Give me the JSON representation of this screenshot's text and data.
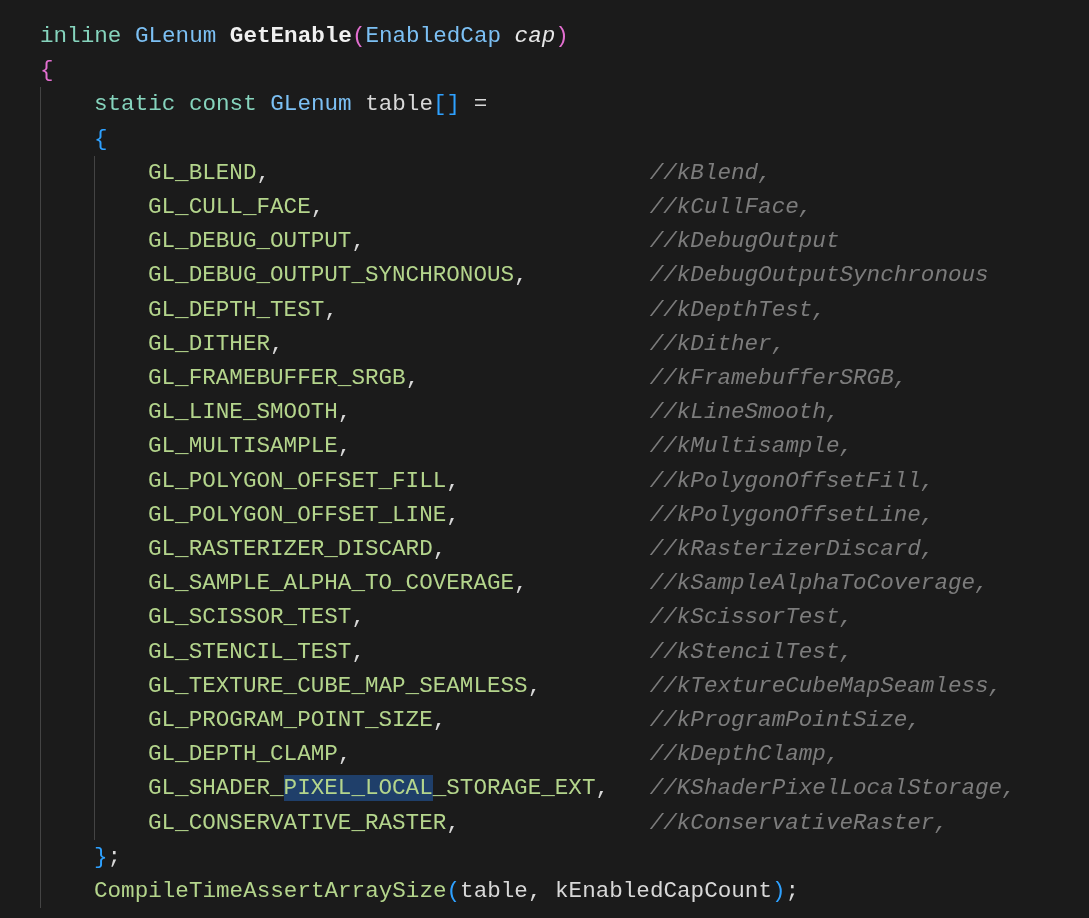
{
  "code": {
    "signature": [
      {
        "text": "inline",
        "kind": "keyword",
        "space_before": false
      },
      {
        "text": "GLenum",
        "kind": "type",
        "space_before": true
      },
      {
        "text": "GetEnable",
        "kind": "function",
        "space_before": true
      },
      {
        "text": "(",
        "kind": "bracket1",
        "space_before": false
      },
      {
        "text": "EnabledCap",
        "kind": "type",
        "space_before": false
      },
      {
        "text": "cap",
        "kind": "param",
        "space_before": true
      },
      {
        "text": ")",
        "kind": "bracket1",
        "space_before": false
      }
    ],
    "open_brace": "{",
    "declaration": {
      "tokens": [
        {
          "text": "static",
          "kind": "keyword",
          "space_before": false
        },
        {
          "text": "const",
          "kind": "keyword",
          "space_before": true
        },
        {
          "text": "GLenum",
          "kind": "type",
          "space_before": true
        },
        {
          "text": "table",
          "kind": "plain",
          "space_before": true
        },
        {
          "text": "[]",
          "kind": "bracket2",
          "space_before": false
        },
        {
          "text": "=",
          "kind": "plain",
          "space_before": true
        }
      ],
      "open_brace": "{",
      "entries": [
        {
          "parts": [
            {
              "text": "GL_BLEND",
              "selected": false
            }
          ],
          "punct": ",",
          "comment": "//kBlend,"
        },
        {
          "parts": [
            {
              "text": "GL_CULL_FACE",
              "selected": false
            }
          ],
          "punct": ",",
          "comment": "//kCullFace,"
        },
        {
          "parts": [
            {
              "text": "GL_DEBUG_OUTPUT",
              "selected": false
            }
          ],
          "punct": ",",
          "comment": "//kDebugOutput"
        },
        {
          "parts": [
            {
              "text": "GL_DEBUG_OUTPUT_SYNCHRONOUS",
              "selected": false
            }
          ],
          "punct": ",",
          "comment": "//kDebugOutputSynchronous"
        },
        {
          "parts": [
            {
              "text": "GL_DEPTH_TEST",
              "selected": false
            }
          ],
          "punct": ",",
          "comment": "//kDepthTest,"
        },
        {
          "parts": [
            {
              "text": "GL_DITHER",
              "selected": false
            }
          ],
          "punct": ",",
          "comment": "//kDither,"
        },
        {
          "parts": [
            {
              "text": "GL_FRAMEBUFFER_SRGB",
              "selected": false
            }
          ],
          "punct": ",",
          "comment": "//kFramebufferSRGB,"
        },
        {
          "parts": [
            {
              "text": "GL_LINE_SMOOTH",
              "selected": false
            }
          ],
          "punct": ",",
          "comment": "//kLineSmooth,"
        },
        {
          "parts": [
            {
              "text": "GL_MULTISAMPLE",
              "selected": false
            }
          ],
          "punct": ",",
          "comment": "//kMultisample,"
        },
        {
          "parts": [
            {
              "text": "GL_POLYGON_OFFSET_FILL",
              "selected": false
            }
          ],
          "punct": ",",
          "comment": "//kPolygonOffsetFill,"
        },
        {
          "parts": [
            {
              "text": "GL_POLYGON_OFFSET_LINE",
              "selected": false
            }
          ],
          "punct": ",",
          "comment": "//kPolygonOffsetLine,"
        },
        {
          "parts": [
            {
              "text": "GL_RASTERIZER_DISCARD",
              "selected": false
            }
          ],
          "punct": ",",
          "comment": "//kRasterizerDiscard,"
        },
        {
          "parts": [
            {
              "text": "GL_SAMPLE_ALPHA_TO_COVERAGE",
              "selected": false
            }
          ],
          "punct": ",",
          "comment": "//kSampleAlphaToCoverage,"
        },
        {
          "parts": [
            {
              "text": "GL_SCISSOR_TEST",
              "selected": false
            }
          ],
          "punct": ",",
          "comment": "//kScissorTest,"
        },
        {
          "parts": [
            {
              "text": "GL_STENCIL_TEST",
              "selected": false
            }
          ],
          "punct": ",",
          "comment": "//kStencilTest,"
        },
        {
          "parts": [
            {
              "text": "GL_TEXTURE_CUBE_MAP_SEAMLESS",
              "selected": false
            }
          ],
          "punct": ",",
          "comment": "//kTextureCubeMapSeamless,"
        },
        {
          "parts": [
            {
              "text": "GL_PROGRAM_POINT_SIZE",
              "selected": false
            }
          ],
          "punct": ",",
          "comment": "//kProgramPointSize,"
        },
        {
          "parts": [
            {
              "text": "GL_DEPTH_CLAMP",
              "selected": false
            }
          ],
          "punct": ",",
          "comment": "//kDepthClamp,"
        },
        {
          "parts": [
            {
              "text": "GL_SHADER_",
              "selected": false
            },
            {
              "text": "PIXEL_LOCAL",
              "selected": true
            },
            {
              "text": "_STORAGE_EXT",
              "selected": false
            }
          ],
          "punct": ",",
          "comment": "//KShaderPixelLocalStorage,"
        },
        {
          "parts": [
            {
              "text": "GL_CONSERVATIVE_RASTER",
              "selected": false
            }
          ],
          "punct": ",",
          "comment": "//kConservativeRaster,"
        }
      ],
      "close": [
        {
          "text": "}",
          "kind": "bracket2",
          "space_before": false
        },
        {
          "text": ";",
          "kind": "plain",
          "space_before": false
        }
      ]
    },
    "call": [
      {
        "text": "CompileTimeAssertArraySize",
        "kind": "call",
        "space_before": false
      },
      {
        "text": "(",
        "kind": "bracket2",
        "space_before": false
      },
      {
        "text": "table,",
        "kind": "plain",
        "space_before": false
      },
      {
        "text": "kEnabledCapCount",
        "kind": "plain",
        "space_before": true
      },
      {
        "text": ")",
        "kind": "bracket2",
        "space_before": false
      },
      {
        "text": ";",
        "kind": "plain",
        "space_before": false
      }
    ]
  }
}
